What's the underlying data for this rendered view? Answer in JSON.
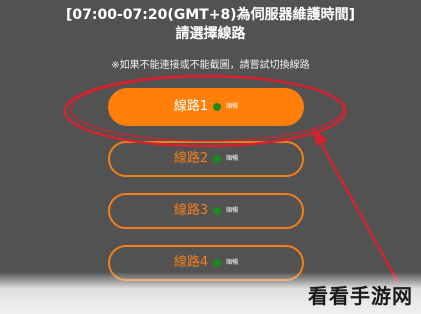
{
  "header": {
    "maintenance_notice": "[07:00-07:20(GMT+8)為伺服器維護時間]",
    "prompt": "請選擇線路",
    "switch_hint": "※如果不能連接或不能截圖，請嘗試切換線路"
  },
  "routes": [
    {
      "label": "線路1",
      "status": "順暢",
      "status_color": "#1e8a1e",
      "selected": true
    },
    {
      "label": "線路2",
      "status": "順暢",
      "status_color": "#1e8a1e",
      "selected": false
    },
    {
      "label": "線路3",
      "status": "順暢",
      "status_color": "#1e8a1e",
      "selected": false
    },
    {
      "label": "線路4",
      "status": "順暢",
      "status_color": "#1e8a1e",
      "selected": false
    }
  ],
  "colors": {
    "accent": "#ff7f0a",
    "background": "#525252",
    "annotation": "#d3232f"
  },
  "watermark": "看看手游网"
}
